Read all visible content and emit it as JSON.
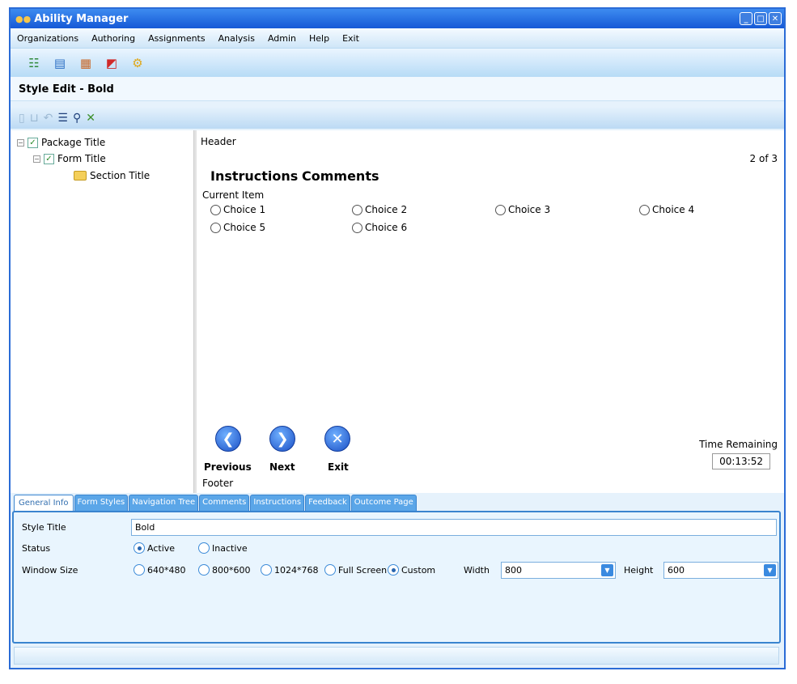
{
  "window": {
    "title": "Ability Manager"
  },
  "menu": [
    "Organizations",
    "Authoring",
    "Assignments",
    "Analysis",
    "Admin",
    "Help",
    "Exit"
  ],
  "page_title": "Style Edit - Bold",
  "tree": [
    {
      "label": "Package Title"
    },
    {
      "label": "Form Title"
    },
    {
      "label": "Section Title"
    }
  ],
  "preview": {
    "header": "Header",
    "page_count": "2 of 3",
    "instructions": "Instructions",
    "comments": "Comments",
    "current_item": "Current Item",
    "choices": [
      "Choice 1",
      "Choice 2",
      "Choice 3",
      "Choice 4",
      "Choice 5",
      "Choice 6"
    ],
    "nav": {
      "previous": "Previous",
      "next": "Next",
      "exit": "Exit"
    },
    "footer": "Footer",
    "time_label": "Time Remaining",
    "time_value": "00:13:52"
  },
  "tabs": [
    "General Info",
    "Form Styles",
    "Navigation Tree",
    "Comments",
    "Instructions",
    "Feedback",
    "Outcome Page"
  ],
  "form": {
    "style_title_label": "Style Title",
    "style_title_value": "Bold",
    "status_label": "Status",
    "status_options": [
      "Active",
      "Inactive"
    ],
    "window_size_label": "Window Size",
    "window_size_options": [
      "640*480",
      "800*600",
      "1024*768",
      "Full Screen",
      "Custom"
    ],
    "width_label": "Width",
    "width_value": "800",
    "height_label": "Height",
    "height_value": "600"
  }
}
